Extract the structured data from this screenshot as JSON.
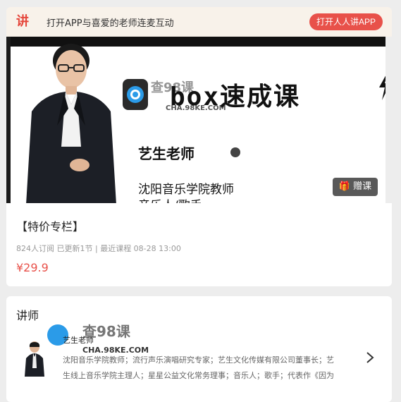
{
  "topbar": {
    "logo_char": "讲",
    "text": "打开APP与喜爱的老师连麦互动",
    "button_label": "打开人人讲APP"
  },
  "banner": {
    "title": "box速成课",
    "teacher_name": "艺生老师",
    "desc_line1": "沈阳音乐学院教师",
    "desc_line2": "音乐人/歌手",
    "gift_label": "赠课",
    "watermark_text": "查98课",
    "watermark_url": "CHA.98KE.COM"
  },
  "course": {
    "title": "【特价专栏】",
    "meta": "824人订阅   已更新1节 | 最近课程 08-28 13:00",
    "price": "¥29.9"
  },
  "teacher_card": {
    "heading": "讲师",
    "name": "艺生老师",
    "line1": "沈阳音乐学院教师；流行声乐演唱研究专家；艺生文化传媒有限公司董事长；艺",
    "line2": "生线上音乐学院主理人；星星公益文化常务理事；音乐人；歌手；代表作《因为",
    "watermark_text": "查98课",
    "watermark_url": "CHA.98KE.COM"
  },
  "colors": {
    "accent": "#e8514a",
    "topbar_bg": "#f8f2ea",
    "page_bg": "#ededed"
  }
}
